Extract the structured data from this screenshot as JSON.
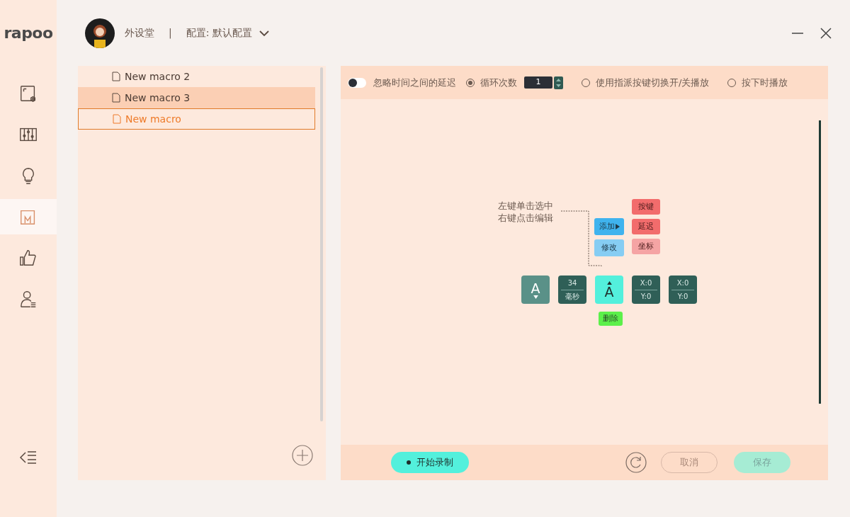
{
  "logo": "rapoo",
  "header": {
    "user": "外设堂",
    "separator": "|",
    "profile": "配置: 默认配置"
  },
  "nav": [
    {
      "kind": "device",
      "selected": false
    },
    {
      "kind": "sliders",
      "selected": false
    },
    {
      "kind": "bulb",
      "selected": false
    },
    {
      "kind": "macro",
      "selected": true
    },
    {
      "kind": "thumb",
      "selected": false
    },
    {
      "kind": "user",
      "selected": false
    }
  ],
  "macros": [
    {
      "name": "New macro 2",
      "selected": false,
      "hovered": false
    },
    {
      "name": "New macro 3",
      "selected": false,
      "hovered": true
    },
    {
      "name": "New macro",
      "selected": true,
      "hovered": false
    }
  ],
  "options": {
    "ignore_delay": {
      "label": "忽略时间之间的延迟",
      "on": false
    },
    "radios": [
      {
        "kind": "count",
        "label": "循环次数",
        "value": "1",
        "selected": true
      },
      {
        "kind": "plain",
        "label": "使用指派按键切换开/关播放",
        "selected": false
      },
      {
        "kind": "plain",
        "label": "按下时播放",
        "selected": false
      }
    ]
  },
  "hint": [
    "左键单击选中",
    "右键点击编辑"
  ],
  "context_menu": {
    "actions": [
      {
        "label": "添加",
        "submenu": true,
        "color": "#3fb3ee"
      },
      {
        "label": "修改",
        "submenu": false,
        "color": "#86cdf3"
      }
    ],
    "submenu": [
      {
        "label": "按键",
        "color": "#f26c6c"
      },
      {
        "label": "延迟",
        "color": "#f26c6c"
      },
      {
        "label": "坐标",
        "color": "#f5a4a4"
      }
    ]
  },
  "steps": [
    {
      "kind": "key",
      "label": "A",
      "released": false,
      "selected": false
    },
    {
      "kind": "delay",
      "value": "34",
      "unit": "毫秒",
      "selected": false
    },
    {
      "kind": "key",
      "label": "A",
      "released": true,
      "selected": true
    },
    {
      "kind": "coord",
      "x": "X:0",
      "y": "Y:0",
      "selected": false
    },
    {
      "kind": "coord",
      "x": "X:0",
      "y": "Y:0",
      "selected": false
    }
  ],
  "delete_label": "删除",
  "footer": {
    "record": "开始录制",
    "cancel": {
      "label": "取消",
      "disabled": true
    },
    "save": {
      "label": "保存",
      "disabled": true
    }
  }
}
